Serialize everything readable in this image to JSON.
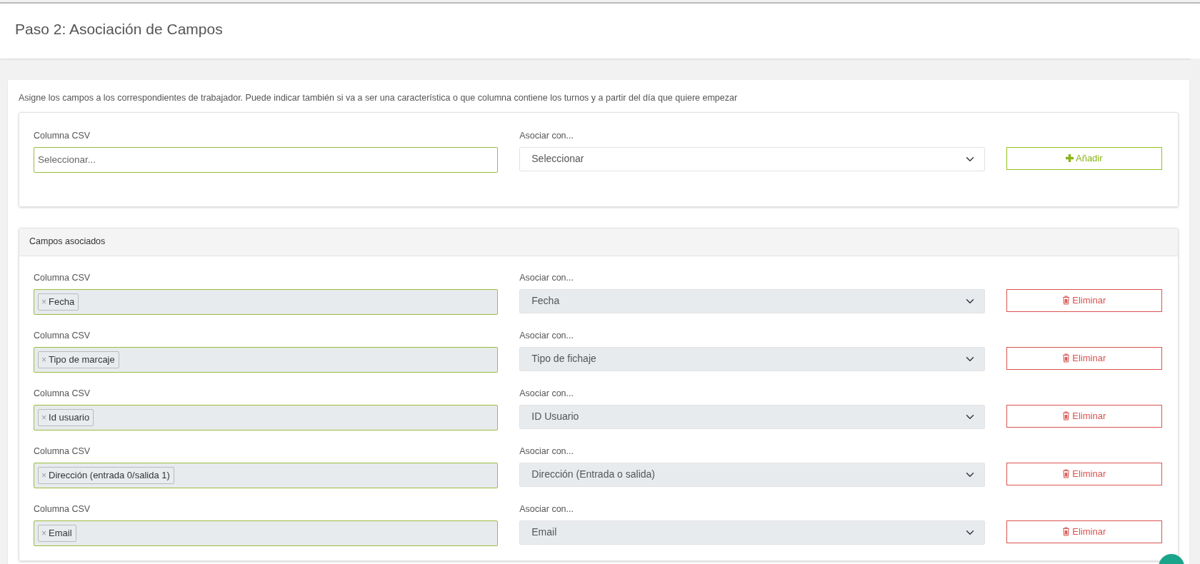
{
  "page": {
    "title": "Paso 2: Asociación de Campos"
  },
  "description": "Asigne los campos a los correspondientes de trabajador. Puede indicar también si va a ser una característica o que columna contiene los turnos y a partir del día que quiere empezar",
  "new_mapping": {
    "csv_label": "Columna CSV",
    "csv_placeholder": "Seleccionar...",
    "assoc_label": "Asociar con...",
    "assoc_value": "Seleccionar",
    "add_button": "Añadir"
  },
  "associated": {
    "title": "Campos asociados",
    "rows": [
      {
        "csv_label": "Columna CSV",
        "tag": "Fecha",
        "tag_remove": "×",
        "assoc_label": "Asociar con...",
        "assoc_value": "Fecha",
        "disabled": true,
        "delete_button": "Eliminar"
      },
      {
        "csv_label": "Columna CSV",
        "tag": "Tipo de marcaje",
        "tag_remove": "×",
        "assoc_label": "Asociar con...",
        "assoc_value": "Tipo de fichaje",
        "disabled": true,
        "delete_button": "Eliminar"
      },
      {
        "csv_label": "Columna CSV",
        "tag": "Id usuario",
        "tag_remove": "×",
        "assoc_label": "Asociar con...",
        "assoc_value": "ID Usuario",
        "disabled": true,
        "delete_button": "Eliminar"
      },
      {
        "csv_label": "Columna CSV",
        "tag": "Dirección (entrada 0/salida 1)",
        "tag_remove": "×",
        "assoc_label": "Asociar con...",
        "assoc_value": "Dirección (Entrada o salida)",
        "disabled": true,
        "delete_button": "Eliminar"
      },
      {
        "csv_label": "Columna CSV",
        "tag": "Email",
        "tag_remove": "×",
        "assoc_label": "Asociar con...",
        "assoc_value": "Email",
        "disabled": true,
        "delete_button": "Eliminar"
      }
    ]
  }
}
